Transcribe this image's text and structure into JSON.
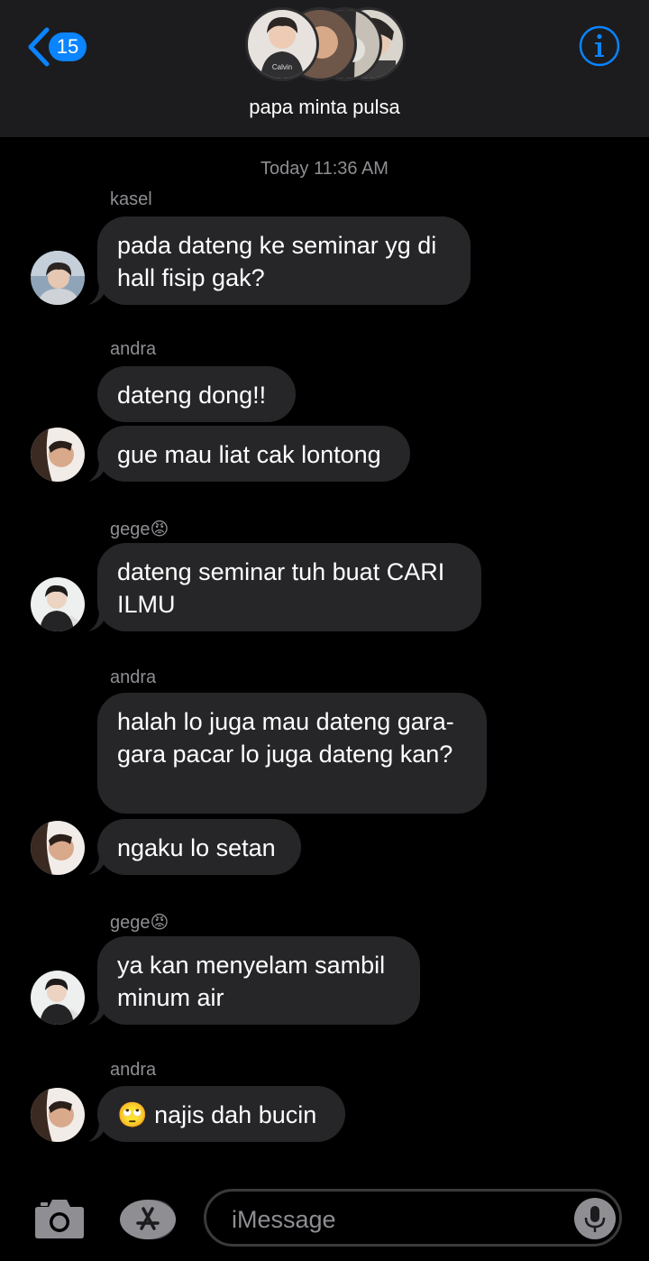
{
  "header": {
    "unread_count": "15",
    "group_name": "papa minta pulsa",
    "avatar_shirt_text": "Calvin"
  },
  "chat": {
    "timestamp": "Today 11:36 AM",
    "groups": [
      {
        "sender": "kasel",
        "messages": [
          "pada dateng ke seminar yg di hall fisip gak?"
        ]
      },
      {
        "sender": "andra",
        "messages": [
          "dateng dong!!",
          "gue mau liat cak lontong"
        ]
      },
      {
        "sender": "gege😡",
        "messages": [
          "dateng seminar tuh buat CARI ILMU"
        ]
      },
      {
        "sender": "andra",
        "messages": [
          "halah lo juga mau dateng gara-gara pacar lo juga dateng kan?",
          "ngaku lo setan"
        ]
      },
      {
        "sender": "gege😡",
        "messages": [
          "ya kan menyelam sambil minum air"
        ]
      },
      {
        "sender": "andra",
        "messages": [
          "🙄 najis dah bucin"
        ]
      }
    ]
  },
  "input": {
    "placeholder": "iMessage"
  },
  "colors": {
    "accent": "#0a84ff",
    "bubble": "#262629",
    "header": "#1c1c1e",
    "meta": "#8e8e93"
  },
  "icons": [
    "back-chevron-icon",
    "info-icon",
    "camera-icon",
    "app-store-icon",
    "microphone-icon"
  ]
}
